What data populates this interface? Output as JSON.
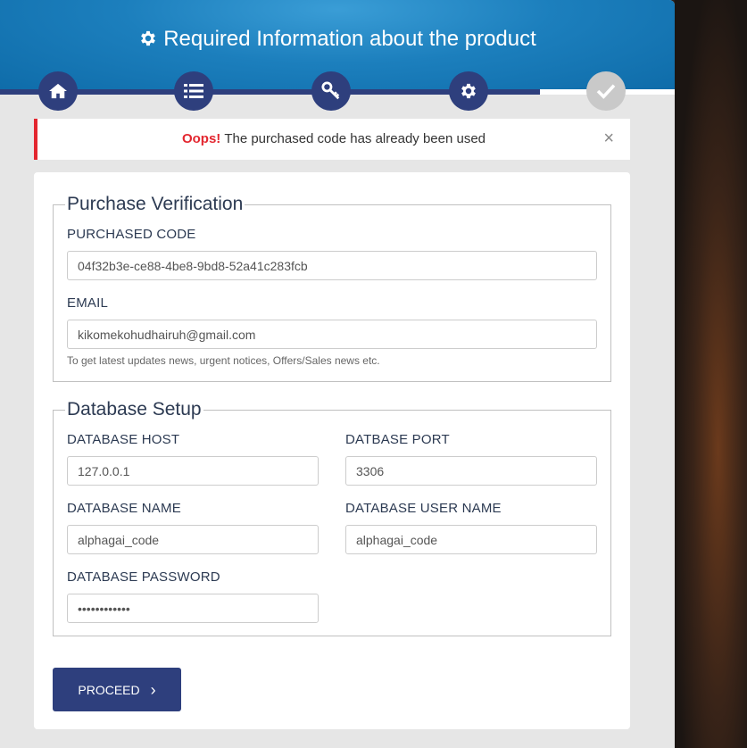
{
  "header": {
    "title": "Required Information about the product",
    "steps": [
      {
        "icon": "home-icon",
        "state": "active"
      },
      {
        "icon": "list-icon",
        "state": "active"
      },
      {
        "icon": "key-icon",
        "state": "active"
      },
      {
        "icon": "gear-icon",
        "state": "active"
      },
      {
        "icon": "check-icon",
        "state": "pending"
      }
    ]
  },
  "alert": {
    "strong": "Oops!",
    "message": "The purchased code has already been used",
    "close": "×"
  },
  "purchase": {
    "legend": "Purchase Verification",
    "code_label": "PURCHASED CODE",
    "code_value": "04f32b3e-ce88-4be8-9bd8-52a41c283fcb",
    "email_label": "EMAIL",
    "email_value": "kikomekohudhairuh@gmail.com",
    "email_help": "To get latest updates news, urgent notices, Offers/Sales news etc."
  },
  "database": {
    "legend": "Database Setup",
    "host_label": "DATABASE HOST",
    "host_value": "127.0.0.1",
    "port_label": "DATBASE PORT",
    "port_value": "3306",
    "name_label": "DATABASE NAME",
    "name_value": "alphagai_code",
    "user_label": "DATABASE USER NAME",
    "user_value": "alphagai_code",
    "password_label": "DATABASE PASSWORD",
    "password_value": "••••••••••••"
  },
  "actions": {
    "proceed_label": "PROCEED",
    "proceed_icon": "›"
  },
  "colors": {
    "primary": "#2e3f7d",
    "header": "#1c7fbd",
    "error": "#e3262f"
  }
}
